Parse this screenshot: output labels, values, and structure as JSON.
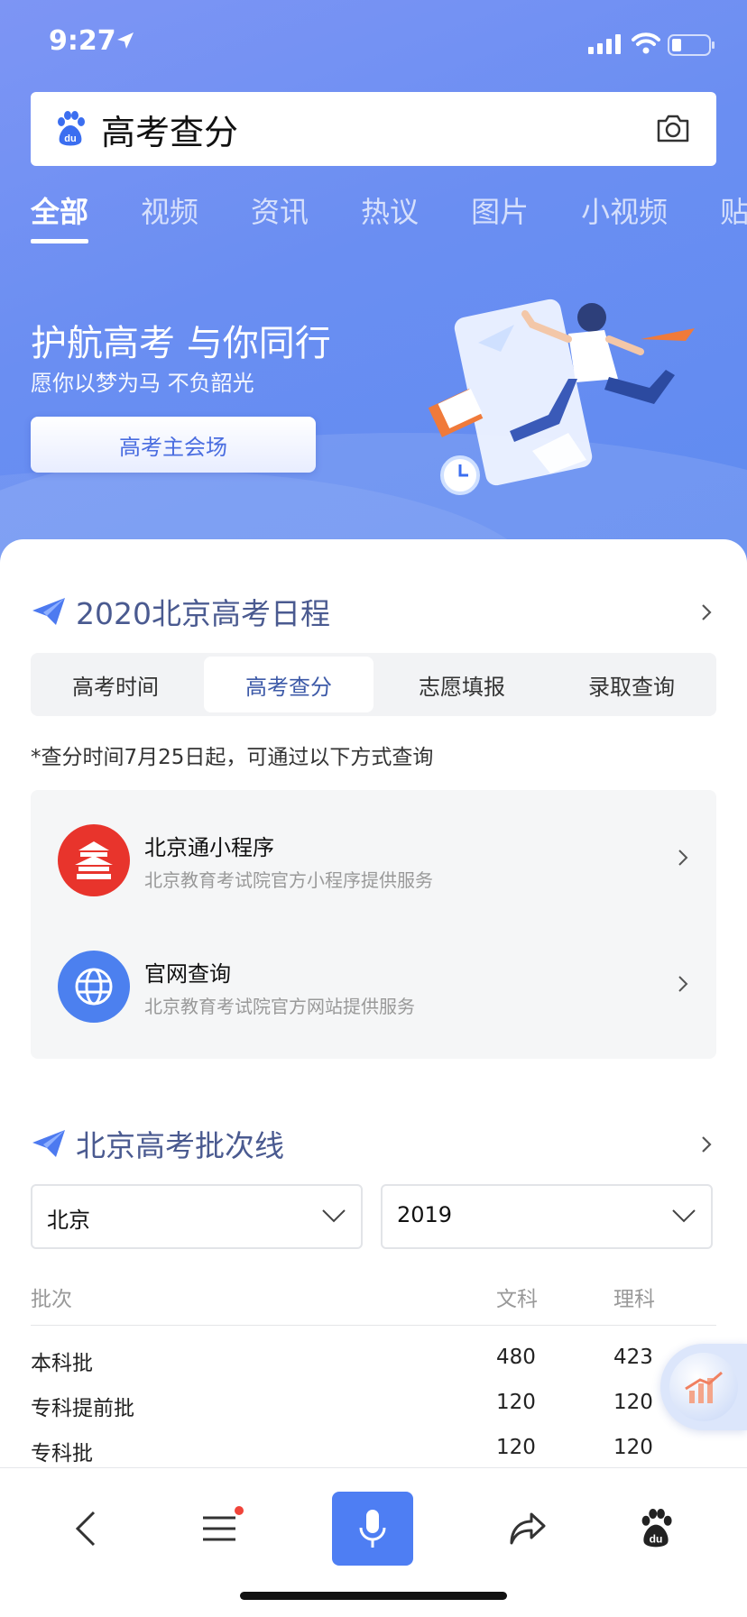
{
  "status_bar": {
    "time": "9:27"
  },
  "search": {
    "query": "高考查分",
    "logo_icon": "baidu-paw-icon",
    "camera_icon": "camera-icon"
  },
  "tabs": [
    {
      "label": "全部",
      "active": true
    },
    {
      "label": "视频"
    },
    {
      "label": "资讯"
    },
    {
      "label": "热议"
    },
    {
      "label": "图片"
    },
    {
      "label": "小视频"
    },
    {
      "label": "贴"
    }
  ],
  "hero": {
    "title": "护航高考 与你同行",
    "subtitle": "愿你以梦为马 不负韶光",
    "button": "高考主会场"
  },
  "schedule": {
    "title": "2020北京高考日程",
    "segments": [
      "高考时间",
      "高考查分",
      "志愿填报",
      "录取查询"
    ],
    "active_segment": 1,
    "note": "*查分时间7月25日起，可通过以下方式查询",
    "services": [
      {
        "name": "北京通小程序",
        "desc": "北京教育考试院官方小程序提供服务",
        "icon": "temple-icon",
        "color": "#e8342c"
      },
      {
        "name": "官网查询",
        "desc": "北京教育考试院官方网站提供服务",
        "icon": "globe-icon",
        "color": "#4c80ef"
      }
    ]
  },
  "cutoff": {
    "title": "北京高考批次线",
    "region": "北京",
    "year": "2019",
    "headers": {
      "batch": "批次",
      "arts": "文科",
      "science": "理科"
    },
    "rows": [
      {
        "batch": "本科批",
        "arts": "480",
        "science": "423"
      },
      {
        "batch": "专科提前批",
        "arts": "120",
        "science": "120"
      },
      {
        "batch": "专科批",
        "arts": "120",
        "science": "120"
      }
    ]
  },
  "bottom_nav": [
    "back-icon",
    "menu-icon",
    "mic-icon",
    "share-icon",
    "baidu-paw-icon"
  ],
  "colors": {
    "accent": "#4e7ef3",
    "title": "#4a5a90",
    "notify_dot": "#f0443a"
  }
}
